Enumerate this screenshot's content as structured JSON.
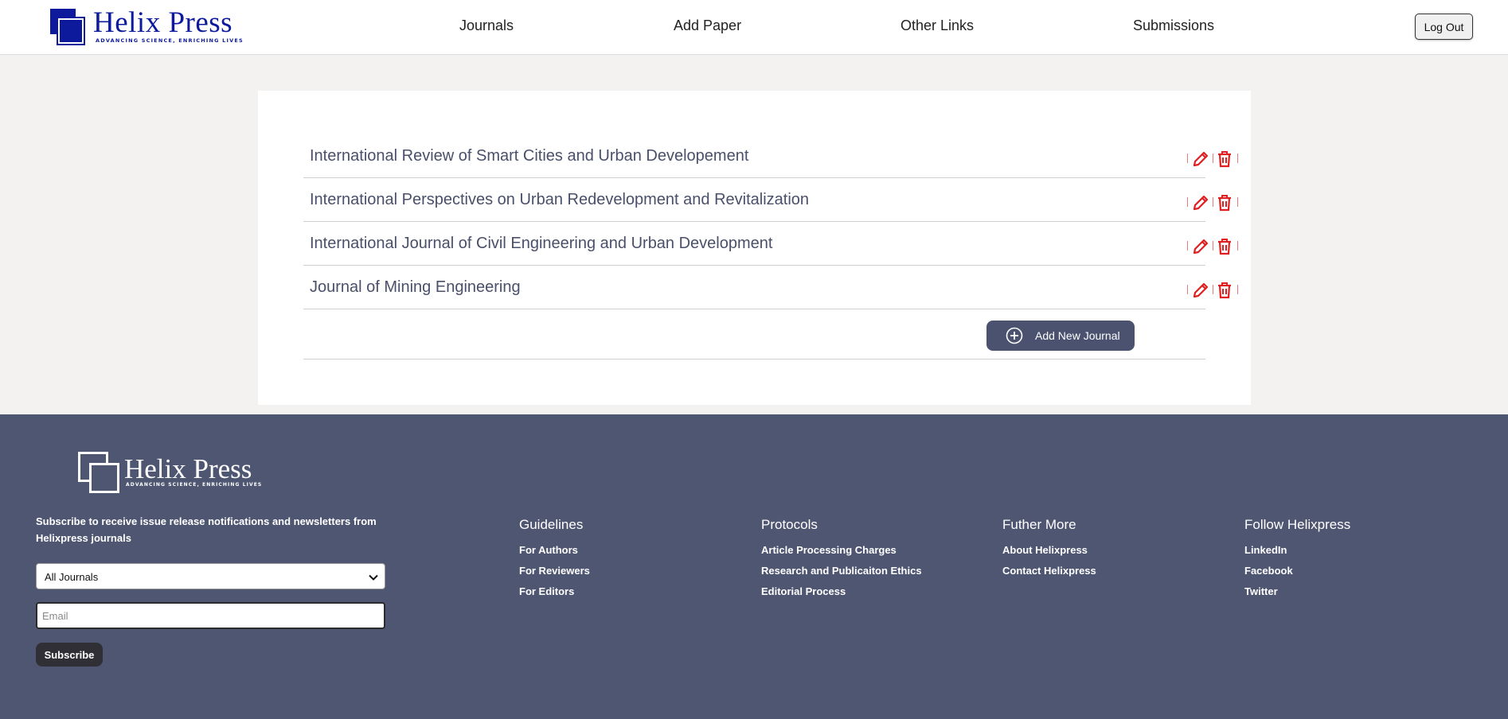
{
  "brand": {
    "name": "Helix Press",
    "tagline": "ADVANCING SCIENCE, ENRICHING LIVES",
    "color": "#0d1a9c"
  },
  "nav": {
    "items": [
      {
        "label": "Journals"
      },
      {
        "label": "Add Paper"
      },
      {
        "label": "Other Links"
      },
      {
        "label": "Submissions"
      }
    ],
    "logout_label": "Log Out"
  },
  "journals": {
    "items": [
      {
        "title": "International Review of Smart Cities and Urban Developement"
      },
      {
        "title": "International Perspectives on Urban Redevelopment and Revitalization"
      },
      {
        "title": "International Journal of Civil Engineering and Urban Development"
      },
      {
        "title": "Journal of Mining Engineering"
      }
    ],
    "edit_icon": "pencil-icon",
    "delete_icon": "trash-icon",
    "action_color": "#e02020",
    "add_button_label": "Add New Journal"
  },
  "footer": {
    "brand_name": "Helix Press",
    "brand_tagline": "ADVANCING SCIENCE, ENRICHING LIVES",
    "subscribe_text": "Subscribe to receive issue release notifications and newsletters from Helixpress journals",
    "journal_select_value": "All Journals",
    "email_placeholder": "Email",
    "subscribe_label": "Subscribe",
    "background": "#4f5672",
    "columns": [
      {
        "title": "Guidelines",
        "links": [
          "For Authors",
          "For Reviewers",
          "For Editors"
        ]
      },
      {
        "title": "Protocols",
        "links": [
          "Article Processing Charges",
          "Research and Publicaiton Ethics",
          "Editorial Process"
        ]
      },
      {
        "title": "Futher More",
        "links": [
          "About Helixpress",
          "Contact Helixpress"
        ]
      },
      {
        "title": "Follow Helixpress",
        "links": [
          "LinkedIn",
          "Facebook",
          "Twitter"
        ]
      }
    ]
  }
}
